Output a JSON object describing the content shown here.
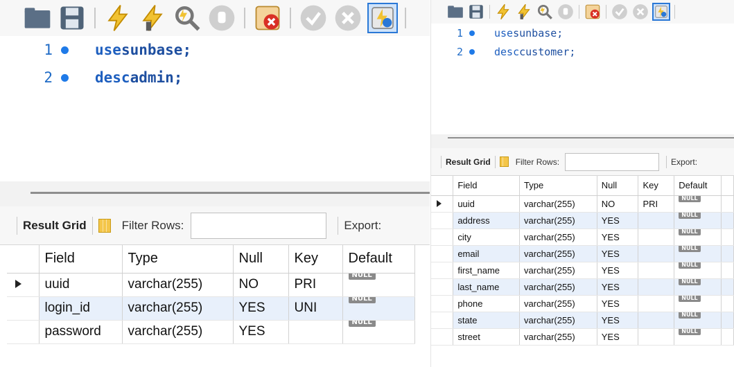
{
  "left": {
    "toolbar": {
      "icons": [
        "open-folder-icon",
        "save-icon",
        "execute-icon",
        "execute-current-icon",
        "explain-icon",
        "stop-icon",
        "toggle-error-icon",
        "commit-icon",
        "rollback-icon",
        "autocommit-icon"
      ]
    },
    "editor": {
      "lines": [
        {
          "num": "1",
          "keyword": "use",
          "rest": "sunbase;"
        },
        {
          "num": "2",
          "keyword": "desc",
          "rest": "admin;"
        }
      ]
    },
    "result_toolbar": {
      "result_grid": "Result Grid",
      "filter_rows": "Filter Rows:",
      "filter_value": "",
      "export": "Export:"
    },
    "grid": {
      "headers": [
        "Field",
        "Type",
        "Null",
        "Key",
        "Default"
      ],
      "rows": [
        {
          "field": "uuid",
          "type": "varchar(255)",
          "null": "NO",
          "key": "PRI",
          "default": "NULL",
          "current": true
        },
        {
          "field": "login_id",
          "type": "varchar(255)",
          "null": "YES",
          "key": "UNI",
          "default": "NULL",
          "current": false
        },
        {
          "field": "password",
          "type": "varchar(255)",
          "null": "YES",
          "key": "",
          "default": "NULL",
          "current": false
        }
      ]
    }
  },
  "right": {
    "editor": {
      "lines": [
        {
          "num": "1",
          "keyword": "use",
          "rest": "sunbase;"
        },
        {
          "num": "2",
          "keyword": "desc",
          "rest": "customer;"
        }
      ]
    },
    "result_toolbar": {
      "result_grid": "Result Grid",
      "filter_rows": "Filter Rows:",
      "filter_value": "",
      "export": "Export:"
    },
    "grid": {
      "headers": [
        "Field",
        "Type",
        "Null",
        "Key",
        "Default"
      ],
      "rows": [
        {
          "field": "uuid",
          "type": "varchar(255)",
          "null": "NO",
          "key": "PRI",
          "default": "NULL",
          "current": true
        },
        {
          "field": "address",
          "type": "varchar(255)",
          "null": "YES",
          "key": "",
          "default": "NULL",
          "current": false
        },
        {
          "field": "city",
          "type": "varchar(255)",
          "null": "YES",
          "key": "",
          "default": "NULL",
          "current": false
        },
        {
          "field": "email",
          "type": "varchar(255)",
          "null": "YES",
          "key": "",
          "default": "NULL",
          "current": false
        },
        {
          "field": "first_name",
          "type": "varchar(255)",
          "null": "YES",
          "key": "",
          "default": "NULL",
          "current": false
        },
        {
          "field": "last_name",
          "type": "varchar(255)",
          "null": "YES",
          "key": "",
          "default": "NULL",
          "current": false
        },
        {
          "field": "phone",
          "type": "varchar(255)",
          "null": "YES",
          "key": "",
          "default": "NULL",
          "current": false
        },
        {
          "field": "state",
          "type": "varchar(255)",
          "null": "YES",
          "key": "",
          "default": "NULL",
          "current": false
        },
        {
          "field": "street",
          "type": "varchar(255)",
          "null": "YES",
          "key": "",
          "default": "NULL",
          "current": false
        }
      ]
    }
  },
  "colors": {
    "line_number": "#1f6bc6",
    "keyword": "#1e5fbf",
    "alt_row": "#e8f0fb",
    "null_badge": "#8a8a8a",
    "active_toggle": "#2a78d6"
  }
}
